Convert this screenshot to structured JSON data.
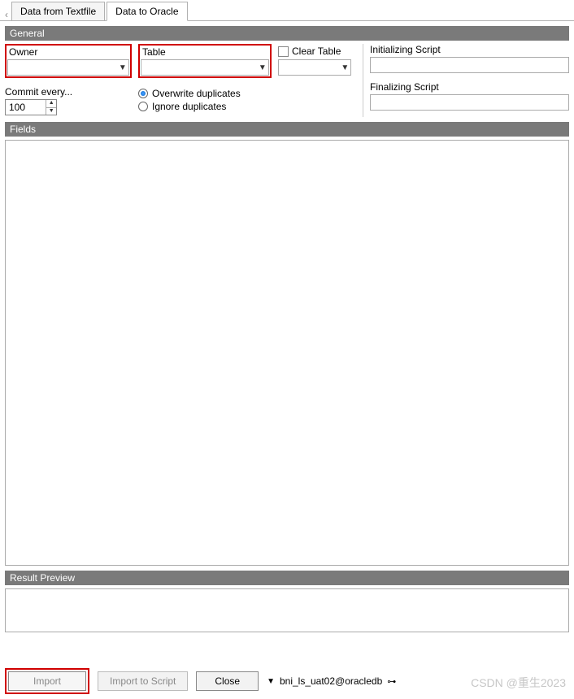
{
  "tabs": {
    "inactive": "Data from Textfile",
    "active": "Data to Oracle"
  },
  "sections": {
    "general": "General",
    "fields": "Fields",
    "result": "Result Preview"
  },
  "general": {
    "owner_label": "Owner",
    "owner_value": "",
    "table_label": "Table",
    "table_value": "",
    "clear_table": "Clear Table",
    "init_label": "Initializing Script",
    "init_value": "",
    "final_label": "Finalizing Script",
    "final_value": "",
    "commit_label": "Commit every...",
    "commit_value": "100",
    "overwrite": "Overwrite duplicates",
    "ignore": "Ignore duplicates"
  },
  "buttons": {
    "import": "Import",
    "import_script": "Import to Script",
    "close": "Close"
  },
  "connection": "bni_ls_uat02@oracledb",
  "watermark": "CSDN @重生2023"
}
